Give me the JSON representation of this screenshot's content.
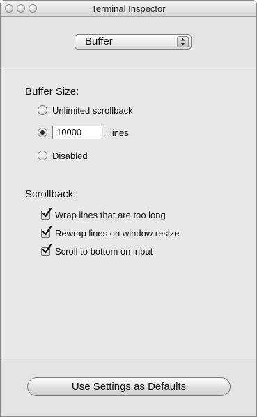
{
  "window": {
    "title": "Terminal Inspector"
  },
  "panel_selector": {
    "selected": "Buffer"
  },
  "buffer_size": {
    "title": "Buffer Size:",
    "options": {
      "unlimited": {
        "label": "Unlimited scrollback",
        "selected": false
      },
      "limited": {
        "value": "10000",
        "unit": "lines",
        "selected": true
      },
      "disabled": {
        "label": "Disabled",
        "selected": false
      }
    }
  },
  "scrollback": {
    "title": "Scrollback:",
    "options": [
      {
        "label": "Wrap lines that are too long",
        "checked": true
      },
      {
        "label": "Rewrap lines on window resize",
        "checked": true
      },
      {
        "label": "Scroll to bottom on input",
        "checked": true
      }
    ]
  },
  "footer": {
    "defaults_button_label": "Use Settings as Defaults"
  }
}
